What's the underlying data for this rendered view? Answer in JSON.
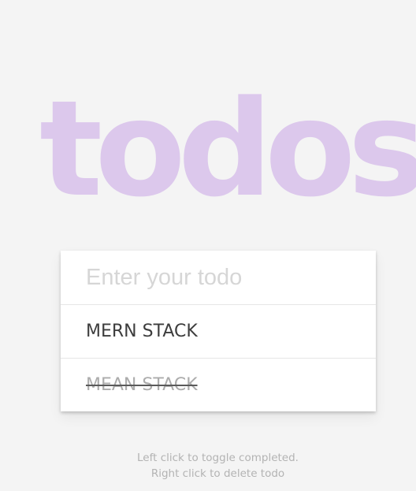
{
  "app": {
    "title": "todos"
  },
  "input": {
    "placeholder": "Enter your todo",
    "value": ""
  },
  "todos": [
    {
      "text": "MERN STACK",
      "completed": false
    },
    {
      "text": "MEAN STACK",
      "completed": true
    }
  ],
  "footer": {
    "line1": "Left click to toggle completed.",
    "line2": "Right click to delete todo"
  },
  "colors": {
    "title": "#dcc8ec",
    "background": "#f4f4f4",
    "card": "#ffffff",
    "completed_text": "#acacac"
  }
}
